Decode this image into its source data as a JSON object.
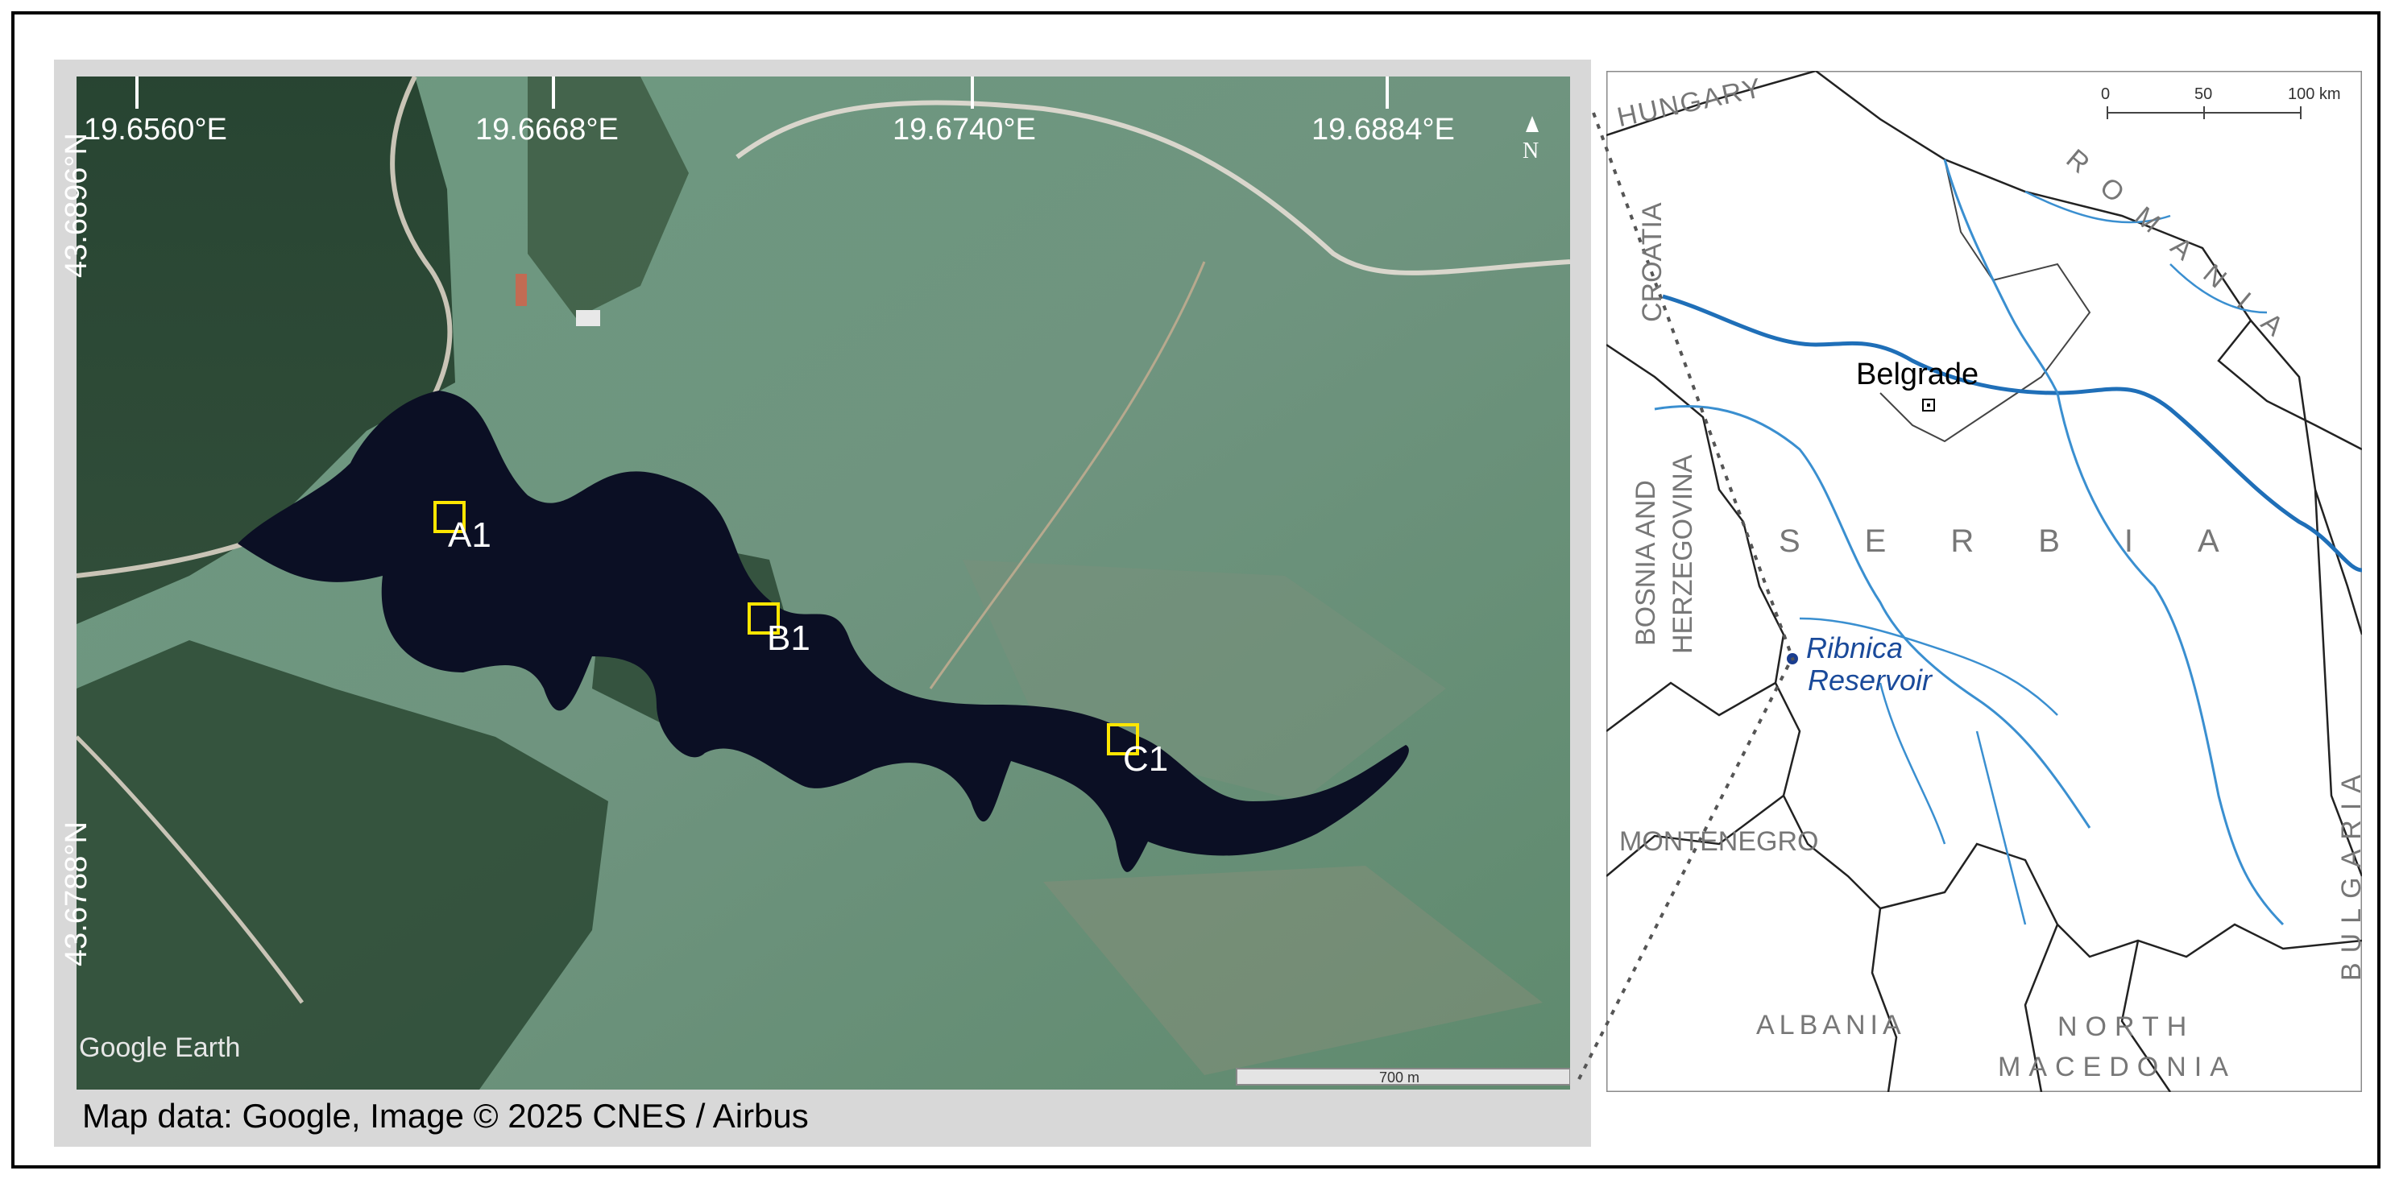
{
  "satellite": {
    "lon_labels": [
      "19.6560°E",
      "19.6668°E",
      "19.6740°E",
      "19.6884°E"
    ],
    "lat_labels": [
      "43.6896°N",
      "43.6788°N"
    ],
    "north_label": "N",
    "sites": [
      "A1",
      "B1",
      "C1"
    ],
    "watermark": "Google Earth",
    "scale_label": "700 m",
    "caption": "Map data: Google, Image © 2025 CNES / Airbus"
  },
  "locator": {
    "scale_ticks": [
      "0",
      "50",
      "100 km"
    ],
    "countries": [
      "HUNGARY",
      "CROATIA",
      "ROMANIA",
      "BOSNIA AND",
      "HERZEGOVINA",
      "SERBIA",
      "MONTENEGRO",
      "ALBANIA",
      "NORTH",
      "MACEDONIA",
      "BULGARIA"
    ],
    "capital": "Belgrade",
    "reservoir_line1": "Ribnica",
    "reservoir_line2": "Reservoir"
  },
  "colors": {
    "water": "#0b0f24",
    "grass": "#5a8a6e",
    "forest": "#1e3a2a",
    "site_marker": "#ffe600",
    "river": "#2a7fc7",
    "reservoir_text": "#1a4a9a"
  }
}
